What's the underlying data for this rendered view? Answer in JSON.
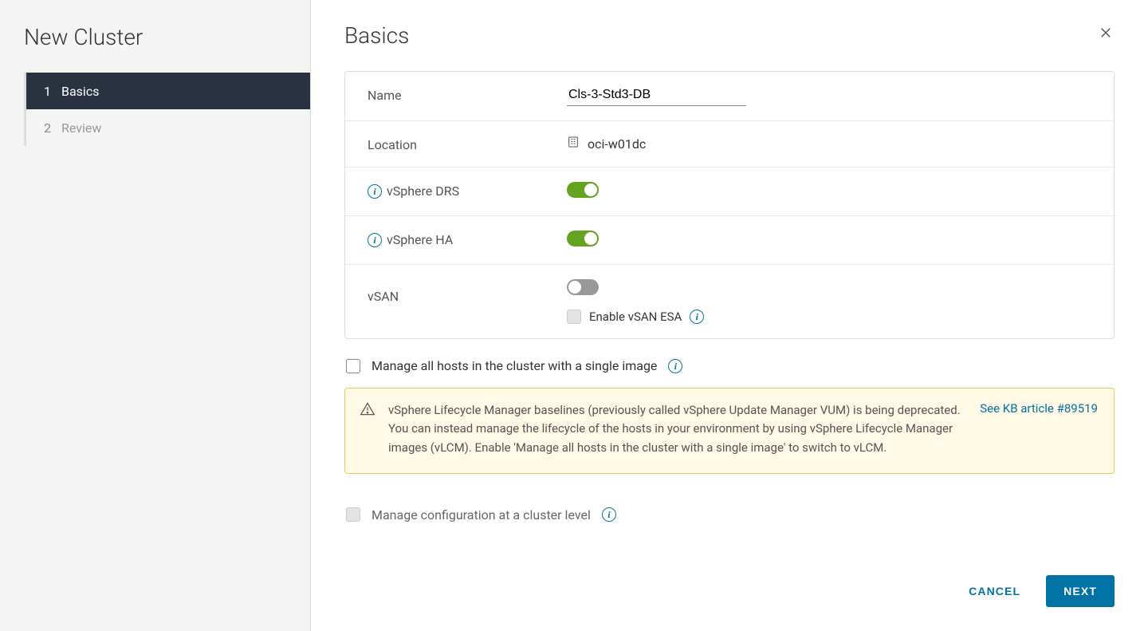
{
  "sidebar": {
    "title": "New Cluster",
    "steps": [
      {
        "num": "1",
        "label": "Basics",
        "active": true
      },
      {
        "num": "2",
        "label": "Review",
        "active": false
      }
    ]
  },
  "header": {
    "title": "Basics"
  },
  "form": {
    "name_label": "Name",
    "name_value": "Cls-3-Std3-DB",
    "location_label": "Location",
    "location_value": "oci-w01dc",
    "drs_label": "vSphere DRS",
    "ha_label": "vSphere HA",
    "vsan_label": "vSAN",
    "vsan_esa_label": "Enable vSAN ESA"
  },
  "options": {
    "manage_single_image_label": "Manage all hosts in the cluster with a single image",
    "manage_cluster_level_label": "Manage configuration at a cluster level"
  },
  "alert": {
    "text": "vSphere Lifecycle Manager baselines (previously called vSphere Update Manager VUM) is being deprecated. You can instead manage the lifecycle of the hosts in your environment by using vSphere Lifecycle Manager images (vLCM). Enable 'Manage all hosts in the cluster with a single image' to switch to vLCM.",
    "link_label": "See KB article #89519"
  },
  "footer": {
    "cancel": "CANCEL",
    "next": "NEXT"
  }
}
